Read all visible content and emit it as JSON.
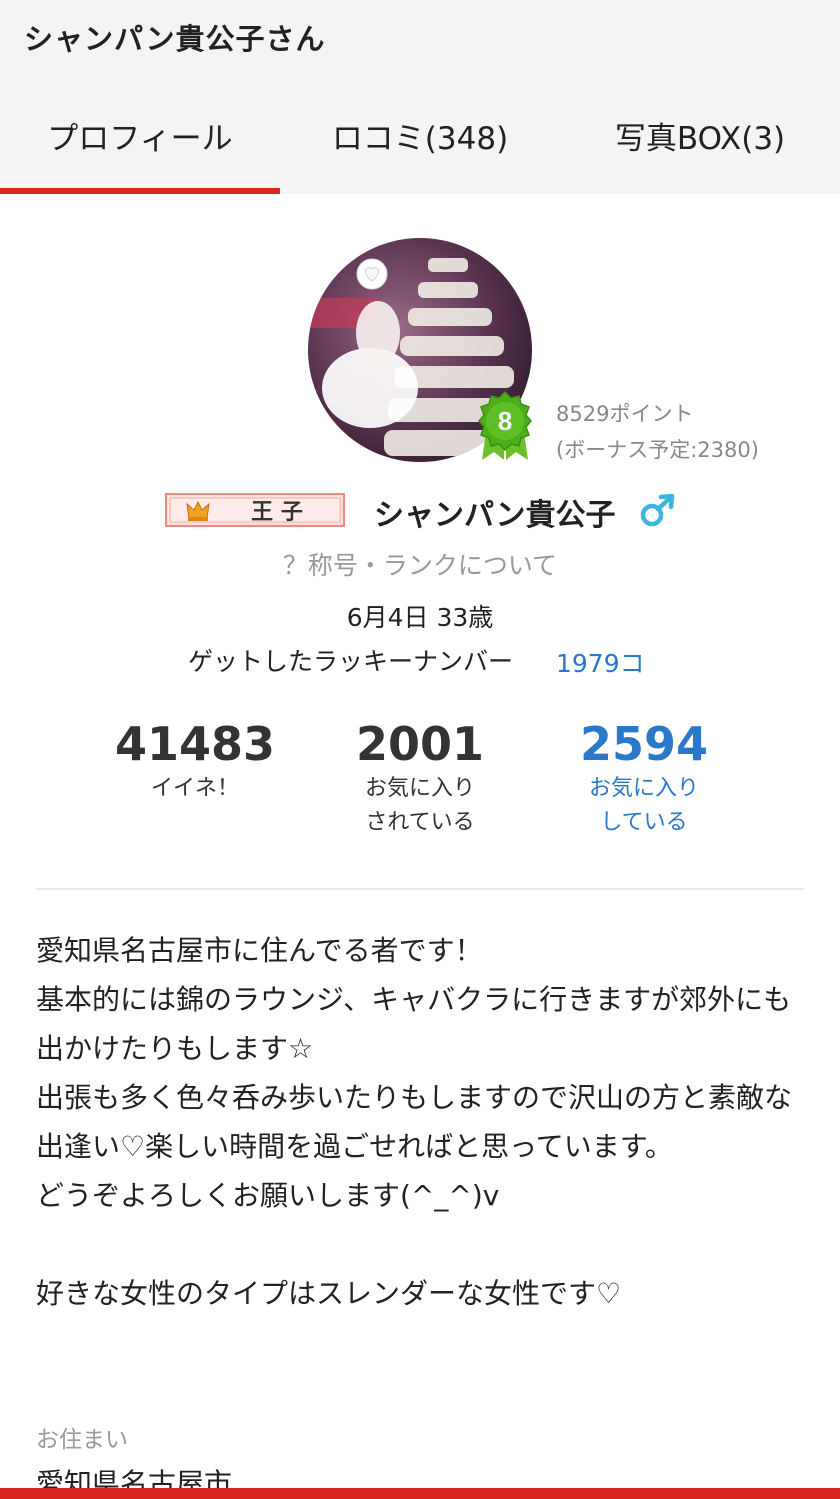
{
  "header": {
    "title": "シャンパン貴公子さん",
    "tabs": [
      {
        "label": "プロフィール",
        "active": true
      },
      {
        "label": "ロコミ(348)",
        "active": false
      },
      {
        "label": "写真BOX(3)",
        "active": false
      }
    ]
  },
  "profile": {
    "rank_level": "8",
    "points": "8529ポイント",
    "bonus": "(ボーナス予定:2380)",
    "title_badge": "王 子",
    "name": "シャンパン貴公子",
    "gender_icon": "male-icon",
    "rank_link": "？称号・ランクについて",
    "birthday": "6月4日 33歳",
    "lucky_label": "ゲットしたラッキーナンバー",
    "lucky_count": "1979コ",
    "stats": {
      "likes": {
        "value": "41483",
        "label": "イイネ！"
      },
      "favorited": {
        "value": "2001",
        "label_1": "お気に入り",
        "label_2": "されている"
      },
      "favoriting": {
        "value": "2594",
        "label_1": "お気に入り",
        "label_2": "している"
      }
    },
    "bio": [
      "愛知県名古屋市に住んでる者です！",
      "基本的には錦のラウンジ、キャバクラに行きますが郊外にも出かけたりもします☆",
      "出張も多く色々呑み歩いたりもしますので沢山の方と素敵な出逢い♡楽しい時間を過ごせればと思っています。",
      "どうぞよろしくお願いします(^_^)v",
      "",
      "好きな女性のタイプはスレンダーな女性です♡"
    ],
    "residence_label": "お住まい",
    "residence_value": "愛知県名古屋市"
  },
  "colors": {
    "accent_red": "#d9251d",
    "link_blue": "#2a78c8",
    "gender_blue": "#3bb6e0",
    "badge_green": "#4caf1a"
  }
}
